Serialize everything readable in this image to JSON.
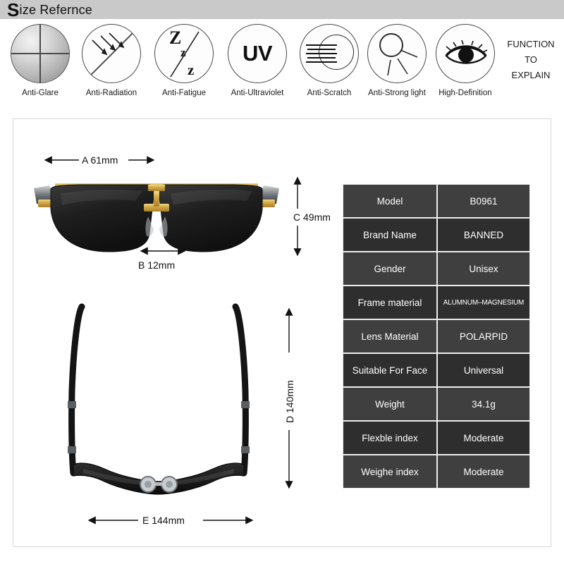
{
  "header": {
    "title_cap": "S",
    "title_rest": "ize Refernce"
  },
  "features": [
    {
      "label": "Anti-Glare",
      "icon": "glare-sphere-icon"
    },
    {
      "label": "Anti-Radiation",
      "icon": "radiation-arrows-icon"
    },
    {
      "label": "Anti-Fatigue",
      "icon": "sleep-zzz-icon"
    },
    {
      "label": "Anti-Ultraviolet",
      "icon": "uv-text-icon"
    },
    {
      "label": "Anti-Scratch",
      "icon": "scratch-lines-icon"
    },
    {
      "label": "Anti-Strong light",
      "icon": "sun-rays-icon"
    },
    {
      "label": "High-Definition",
      "icon": "eye-icon"
    }
  ],
  "function_note": {
    "line1": "FUNCTION",
    "line2": "TO",
    "line3": "EXPLAIN"
  },
  "dimensions": {
    "a": "A 61mm",
    "b": "B 12mm",
    "c": "C 49mm",
    "d": "D 140mm",
    "e": "E 144mm"
  },
  "spec_table": {
    "rows": [
      {
        "key": "Model",
        "value": "B0961"
      },
      {
        "key": "Brand Name",
        "value": "BANNED"
      },
      {
        "key": "Gender",
        "value": "Unisex"
      },
      {
        "key": "Frame material",
        "value": "ALUMNUM–MAGNESIUM"
      },
      {
        "key": "Lens Material",
        "value": "POLARPID"
      },
      {
        "key": "Suitable For Face",
        "value": "Universal"
      },
      {
        "key": "Weight",
        "value": "34.1g"
      },
      {
        "key": "Flexble index",
        "value": "Moderate"
      },
      {
        "key": "Weighe index",
        "value": "Moderate"
      }
    ]
  },
  "colors": {
    "header_band": "#c9c9c9",
    "table_row_light": "#3f3f3f",
    "table_row_dark": "#2e2e2e",
    "frame_gold": "#d4a843",
    "lens_dark": "#232323",
    "panel_border": "#d7d7d7"
  }
}
